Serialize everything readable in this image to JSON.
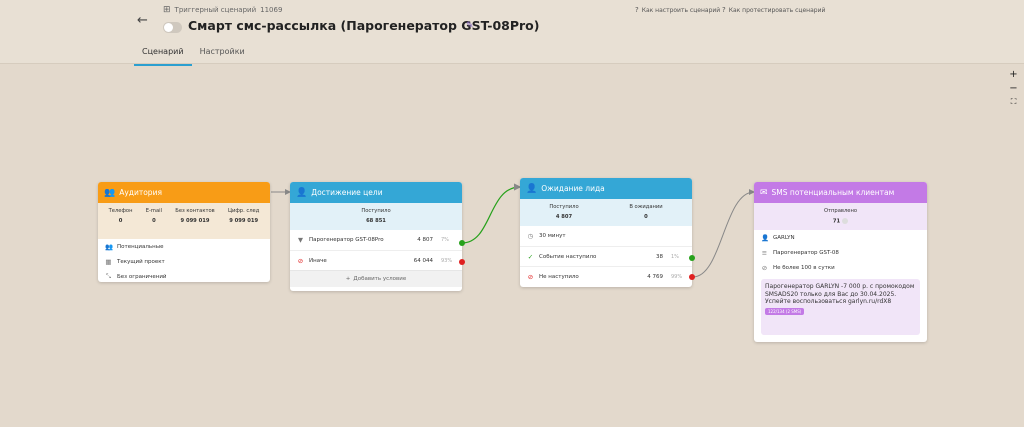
{
  "header": {
    "breadcrumb_type": "Триггерный сценарий",
    "breadcrumb_id": "11069",
    "title": "Смарт смс-рассылка (Парогенератор GST-08Pro)",
    "help_setup": "Как настроить сценарий",
    "help_test": "Как протестировать сценарий",
    "tabs": [
      "Сценарий",
      "Настройки"
    ]
  },
  "zoom": {
    "plus": "+",
    "minus": "−",
    "fit": "⛶"
  },
  "audience": {
    "title": "Аудитория",
    "stats": [
      {
        "label": "Телефон",
        "value": "0"
      },
      {
        "label": "E-mail",
        "value": "0"
      },
      {
        "label": "Без контактов",
        "value": "9 099 019"
      },
      {
        "label": "Цифр. след",
        "value": "9 099 019"
      }
    ],
    "rows": [
      "Потенциальные",
      "Текущий проект",
      "Без ограничений"
    ]
  },
  "goal": {
    "title": "Достижение цели",
    "received_label": "Поступило",
    "received_value": "68 851",
    "row1_label": "Парогенератор GST-08Pro",
    "row1_value": "4 807",
    "row1_pct": "7%",
    "row2_label": "Иначе",
    "row2_value": "64 044",
    "row2_pct": "93%",
    "add_condition": "Добавить условие"
  },
  "wait": {
    "title": "Ожидание лида",
    "received_label": "Поступило",
    "received_value": "4 807",
    "waiting_label": "В ожидании",
    "waiting_value": "0",
    "row1_label": "30 минут",
    "row2_label": "Событие наступило",
    "row2_value": "38",
    "row2_pct": "1%",
    "row3_label": "Не наступило",
    "row3_value": "4 769",
    "row3_pct": "99%"
  },
  "sms": {
    "title": "SMS потенциальным клиентам",
    "sent_label": "Отправлено",
    "sent_value": "71",
    "row1": "GARLYN",
    "row2": "Парогенератор GST-08",
    "row3": "Не более 100 в сутки",
    "message": "Парогенератор GARLYN -7 000 р. с промокодом SMSADS20 только для Вас до 30.04.2025. Успейте воспользоваться garlyn.ru/rdX8",
    "badge": "122/134 (2 SMS)"
  },
  "colors": {
    "audience": "#f89c16",
    "goal": "#34a7d6",
    "sms": "#c37ae6",
    "yes": "#27a11b",
    "no": "#e02020"
  }
}
